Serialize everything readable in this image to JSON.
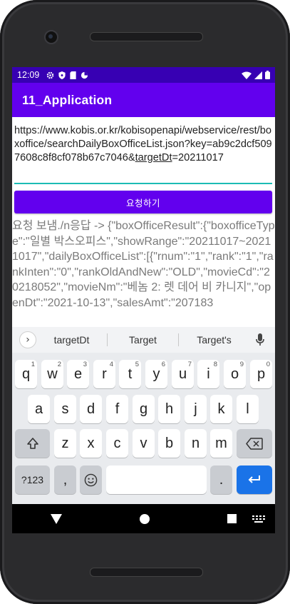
{
  "status_bar": {
    "time": "12:09",
    "icons_left": [
      "settings-icon",
      "shield-icon",
      "sd-card-icon",
      "data-saver-icon"
    ],
    "icons_right": [
      "wifi-icon",
      "cell-signal-icon",
      "battery-icon"
    ]
  },
  "app_bar": {
    "title": "11_Application"
  },
  "url_input": {
    "value_prefix": "https://www.kobis.or.kr/kobisopenapi/webservice/rest/boxoffice/searchDailyBoxOfficeList.json?key=ab9c2dcf5097608c8f8cf078b67c7046&",
    "value_underlined": "targetDt",
    "value_suffix": "=20211017"
  },
  "request_button": {
    "label": "요청하기"
  },
  "response": {
    "text": "요청 보냄./n응답 -> {\"boxOfficeResult\":{\"boxofficeType\":\"일별 박스오피스\",\"showRange\":\"20211017~20211017\",\"dailyBoxOfficeList\":[{\"rnum\":\"1\",\"rank\":\"1\",\"rankInten\":\"0\",\"rankOldAndNew\":\"OLD\",\"movieCd\":\"20218052\",\"movieNm\":\"베놈 2: 렛 데어 비 카니지\",\"openDt\":\"2021-10-13\",\"salesAmt\":\"207183"
  },
  "keyboard": {
    "expand_icon": "chevron-right-icon",
    "suggestions": [
      "targetDt",
      "Target",
      "Target's"
    ],
    "row1": [
      {
        "key": "q",
        "num": "1"
      },
      {
        "key": "w",
        "num": "2"
      },
      {
        "key": "e",
        "num": "3"
      },
      {
        "key": "r",
        "num": "4"
      },
      {
        "key": "t",
        "num": "5"
      },
      {
        "key": "y",
        "num": "6"
      },
      {
        "key": "u",
        "num": "7"
      },
      {
        "key": "i",
        "num": "8"
      },
      {
        "key": "o",
        "num": "9"
      },
      {
        "key": "p",
        "num": "0"
      }
    ],
    "row2": [
      "a",
      "s",
      "d",
      "f",
      "g",
      "h",
      "j",
      "k",
      "l"
    ],
    "row3": [
      "z",
      "x",
      "c",
      "v",
      "b",
      "n",
      "m"
    ],
    "symbols_label": "?123",
    "comma_label": ",",
    "period_label": "."
  },
  "colors": {
    "status_bar": "#3700b3",
    "primary": "#6200ee",
    "accent": "#1cbcb4",
    "enter_key": "#1a73e8"
  }
}
